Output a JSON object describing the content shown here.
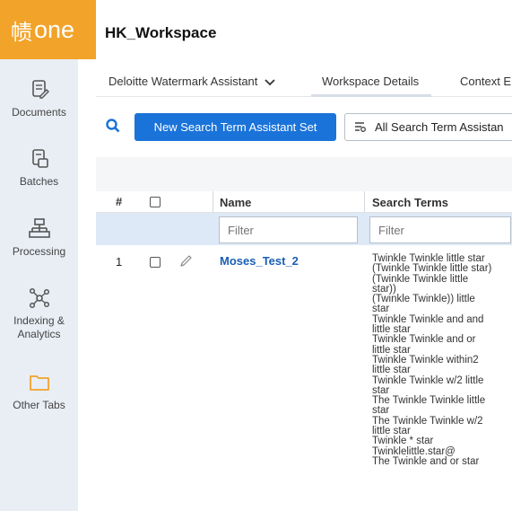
{
  "app": {
    "logo_text": "one"
  },
  "sidebar": {
    "items": [
      {
        "label": "Documents",
        "icon": "documents-icon"
      },
      {
        "label": "Batches",
        "icon": "batches-icon"
      },
      {
        "label": "Processing",
        "icon": "processing-icon"
      },
      {
        "label": "Indexing &\nAnalytics",
        "icon": "analytics-icon"
      },
      {
        "label": "Other Tabs",
        "icon": "folder-icon"
      }
    ]
  },
  "header": {
    "workspace_title": "HK_Workspace"
  },
  "tabs": [
    {
      "label": "Deloitte Watermark Assistant"
    },
    {
      "label": "Workspace Details"
    },
    {
      "label": "Context E"
    }
  ],
  "toolbar": {
    "new_set_label": "New Search Term Assistant Set",
    "view_label": "All Search Term Assistan"
  },
  "grid": {
    "columns": {
      "number": "#",
      "name": "Name",
      "search_terms": "Search Terms"
    },
    "filter_placeholder": "Filter",
    "rows": [
      {
        "number": "1",
        "name": "Moses_Test_2",
        "search_terms": [
          "Twinkle Twinkle little star",
          "(Twinkle Twinkle little star)",
          "(Twinkle Twinkle little",
          "star))",
          "(Twinkle Twinkle)) little",
          "star",
          "Twinkle Twinkle and and",
          "little star",
          "Twinkle Twinkle and or",
          "little star",
          "Twinkle Twinkle within2",
          "little star",
          "Twinkle Twinkle w/2 little",
          "star",
          "The Twinkle Twinkle little",
          "star",
          "The Twinkle Twinkle w/2",
          "little star",
          "Twinkle * star",
          "Twinklelittle.star@",
          "The Twinkle and or star"
        ]
      }
    ]
  },
  "colors": {
    "accent": "#1a73d9",
    "logo_bg": "#f2a32a",
    "sidebar_bg": "#e9eef5",
    "filter_row_bg": "#dde9f6"
  }
}
